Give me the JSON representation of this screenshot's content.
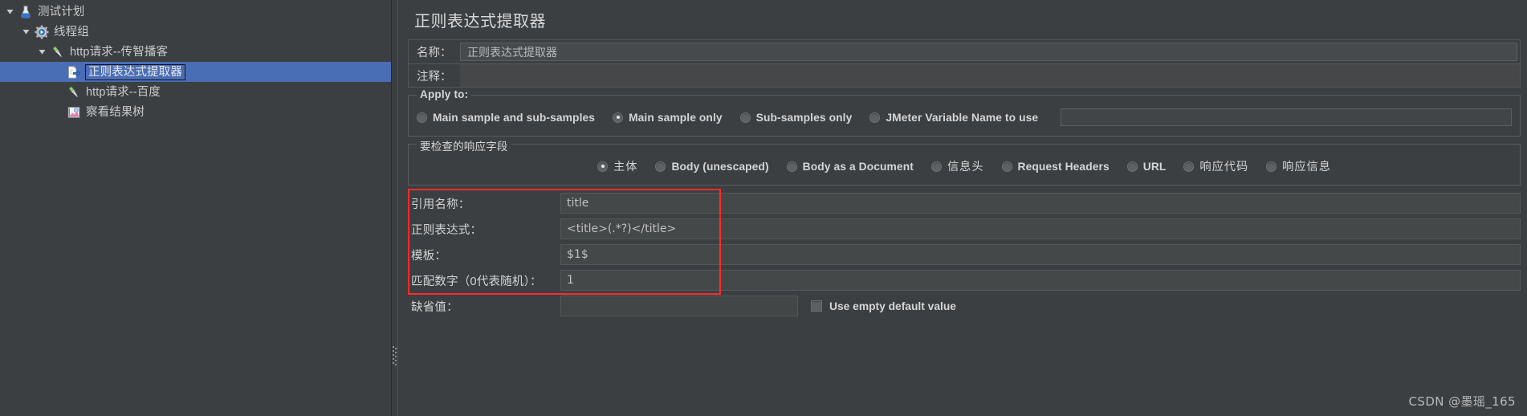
{
  "sidebar": {
    "tree": [
      {
        "label": "测试计划",
        "depth": 0,
        "icon": "test-plan-icon",
        "twisty": "expanded",
        "selected": false
      },
      {
        "label": "线程组",
        "depth": 1,
        "icon": "thread-group-icon",
        "twisty": "expanded",
        "selected": false
      },
      {
        "label": "http请求--传智播客",
        "depth": 2,
        "icon": "http-sampler-icon",
        "twisty": "expanded",
        "selected": false
      },
      {
        "label": "正则表达式提取器",
        "depth": 3,
        "icon": "post-processor-icon",
        "twisty": "none",
        "selected": true
      },
      {
        "label": "http请求--百度",
        "depth": 3,
        "icon": "http-sampler-icon",
        "twisty": "none",
        "selected": false
      },
      {
        "label": "察看结果树",
        "depth": 3,
        "icon": "view-results-tree-icon",
        "twisty": "none",
        "selected": false
      }
    ]
  },
  "main": {
    "title": "正则表达式提取器",
    "name_label": "名称：",
    "name_value": "正则表达式提取器",
    "comment_label": "注释：",
    "comment_value": "",
    "apply_to": {
      "legend": "Apply to:",
      "options": [
        {
          "label": "Main sample and sub-samples",
          "selected": false
        },
        {
          "label": "Main sample only",
          "selected": true
        },
        {
          "label": "Sub-samples only",
          "selected": false
        },
        {
          "label": "JMeter Variable Name to use",
          "selected": false
        }
      ],
      "variable_name_value": ""
    },
    "response_field": {
      "legend": "要检查的响应字段",
      "options": [
        {
          "label": "主体",
          "selected": true,
          "cjk": true
        },
        {
          "label": "Body (unescaped)",
          "selected": false,
          "cjk": false
        },
        {
          "label": "Body as a Document",
          "selected": false,
          "cjk": false
        },
        {
          "label": "信息头",
          "selected": false,
          "cjk": true
        },
        {
          "label": "Request Headers",
          "selected": false,
          "cjk": false
        },
        {
          "label": "URL",
          "selected": false,
          "cjk": false
        },
        {
          "label": "响应代码",
          "selected": false,
          "cjk": true
        },
        {
          "label": "响应信息",
          "selected": false,
          "cjk": true
        }
      ]
    },
    "params": [
      {
        "label": "引用名称：",
        "value": "title"
      },
      {
        "label": "正则表达式：",
        "value": "<title>(.*?)</title>"
      },
      {
        "label": "模板：",
        "value": "$1$"
      },
      {
        "label": "匹配数字（0代表随机）：",
        "value": "1"
      }
    ],
    "default_value": {
      "label": "缺省值：",
      "value": "",
      "checkbox_label": "Use empty default value",
      "checkbox_checked": false
    }
  },
  "watermark": "CSDN @墨瑶_165",
  "colors": {
    "background": "#3c3f41",
    "selection": "#4a6eb5",
    "highlight_box": "#ff2b2b",
    "text": "#d0d2d4"
  }
}
